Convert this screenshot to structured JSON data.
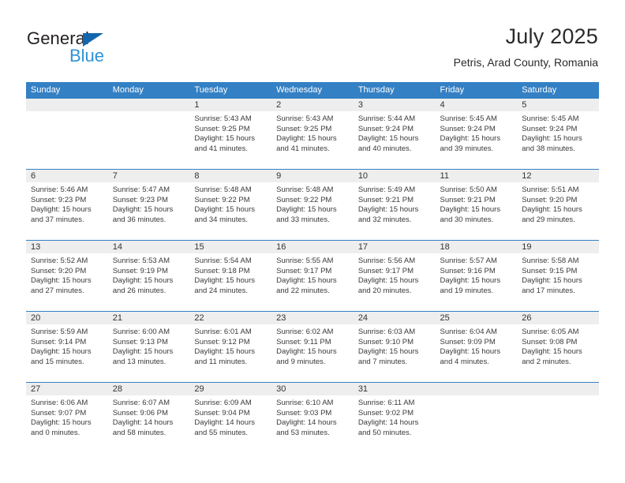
{
  "brand": {
    "name_part1": "General",
    "name_part2": "Blue",
    "triangle_icon": "triangle-icon",
    "accent_dark": "#1266ad",
    "accent_light": "#2e93d8"
  },
  "header": {
    "title": "July 2025",
    "subtitle": "Petris, Arad County, Romania"
  },
  "theme": {
    "header_band": "#3480c4",
    "daynum_band": "#eeeeee",
    "text": "#333333",
    "page_background": "#ffffff"
  },
  "weekdays": [
    "Sunday",
    "Monday",
    "Tuesday",
    "Wednesday",
    "Thursday",
    "Friday",
    "Saturday"
  ],
  "labels": {
    "sunrise_prefix": "Sunrise:",
    "sunset_prefix": "Sunset:",
    "daylight_prefix": "Daylight:"
  },
  "weeks": [
    [
      {
        "day": "",
        "line1": "",
        "line2": "",
        "line3": "",
        "line4": ""
      },
      {
        "day": "",
        "line1": "",
        "line2": "",
        "line3": "",
        "line4": ""
      },
      {
        "day": "1",
        "line1": "Sunrise: 5:43 AM",
        "line2": "Sunset: 9:25 PM",
        "line3": "Daylight: 15 hours",
        "line4": "and 41 minutes."
      },
      {
        "day": "2",
        "line1": "Sunrise: 5:43 AM",
        "line2": "Sunset: 9:25 PM",
        "line3": "Daylight: 15 hours",
        "line4": "and 41 minutes."
      },
      {
        "day": "3",
        "line1": "Sunrise: 5:44 AM",
        "line2": "Sunset: 9:24 PM",
        "line3": "Daylight: 15 hours",
        "line4": "and 40 minutes."
      },
      {
        "day": "4",
        "line1": "Sunrise: 5:45 AM",
        "line2": "Sunset: 9:24 PM",
        "line3": "Daylight: 15 hours",
        "line4": "and 39 minutes."
      },
      {
        "day": "5",
        "line1": "Sunrise: 5:45 AM",
        "line2": "Sunset: 9:24 PM",
        "line3": "Daylight: 15 hours",
        "line4": "and 38 minutes."
      }
    ],
    [
      {
        "day": "6",
        "line1": "Sunrise: 5:46 AM",
        "line2": "Sunset: 9:23 PM",
        "line3": "Daylight: 15 hours",
        "line4": "and 37 minutes."
      },
      {
        "day": "7",
        "line1": "Sunrise: 5:47 AM",
        "line2": "Sunset: 9:23 PM",
        "line3": "Daylight: 15 hours",
        "line4": "and 36 minutes."
      },
      {
        "day": "8",
        "line1": "Sunrise: 5:48 AM",
        "line2": "Sunset: 9:22 PM",
        "line3": "Daylight: 15 hours",
        "line4": "and 34 minutes."
      },
      {
        "day": "9",
        "line1": "Sunrise: 5:48 AM",
        "line2": "Sunset: 9:22 PM",
        "line3": "Daylight: 15 hours",
        "line4": "and 33 minutes."
      },
      {
        "day": "10",
        "line1": "Sunrise: 5:49 AM",
        "line2": "Sunset: 9:21 PM",
        "line3": "Daylight: 15 hours",
        "line4": "and 32 minutes."
      },
      {
        "day": "11",
        "line1": "Sunrise: 5:50 AM",
        "line2": "Sunset: 9:21 PM",
        "line3": "Daylight: 15 hours",
        "line4": "and 30 minutes."
      },
      {
        "day": "12",
        "line1": "Sunrise: 5:51 AM",
        "line2": "Sunset: 9:20 PM",
        "line3": "Daylight: 15 hours",
        "line4": "and 29 minutes."
      }
    ],
    [
      {
        "day": "13",
        "line1": "Sunrise: 5:52 AM",
        "line2": "Sunset: 9:20 PM",
        "line3": "Daylight: 15 hours",
        "line4": "and 27 minutes."
      },
      {
        "day": "14",
        "line1": "Sunrise: 5:53 AM",
        "line2": "Sunset: 9:19 PM",
        "line3": "Daylight: 15 hours",
        "line4": "and 26 minutes."
      },
      {
        "day": "15",
        "line1": "Sunrise: 5:54 AM",
        "line2": "Sunset: 9:18 PM",
        "line3": "Daylight: 15 hours",
        "line4": "and 24 minutes."
      },
      {
        "day": "16",
        "line1": "Sunrise: 5:55 AM",
        "line2": "Sunset: 9:17 PM",
        "line3": "Daylight: 15 hours",
        "line4": "and 22 minutes."
      },
      {
        "day": "17",
        "line1": "Sunrise: 5:56 AM",
        "line2": "Sunset: 9:17 PM",
        "line3": "Daylight: 15 hours",
        "line4": "and 20 minutes."
      },
      {
        "day": "18",
        "line1": "Sunrise: 5:57 AM",
        "line2": "Sunset: 9:16 PM",
        "line3": "Daylight: 15 hours",
        "line4": "and 19 minutes."
      },
      {
        "day": "19",
        "line1": "Sunrise: 5:58 AM",
        "line2": "Sunset: 9:15 PM",
        "line3": "Daylight: 15 hours",
        "line4": "and 17 minutes."
      }
    ],
    [
      {
        "day": "20",
        "line1": "Sunrise: 5:59 AM",
        "line2": "Sunset: 9:14 PM",
        "line3": "Daylight: 15 hours",
        "line4": "and 15 minutes."
      },
      {
        "day": "21",
        "line1": "Sunrise: 6:00 AM",
        "line2": "Sunset: 9:13 PM",
        "line3": "Daylight: 15 hours",
        "line4": "and 13 minutes."
      },
      {
        "day": "22",
        "line1": "Sunrise: 6:01 AM",
        "line2": "Sunset: 9:12 PM",
        "line3": "Daylight: 15 hours",
        "line4": "and 11 minutes."
      },
      {
        "day": "23",
        "line1": "Sunrise: 6:02 AM",
        "line2": "Sunset: 9:11 PM",
        "line3": "Daylight: 15 hours",
        "line4": "and 9 minutes."
      },
      {
        "day": "24",
        "line1": "Sunrise: 6:03 AM",
        "line2": "Sunset: 9:10 PM",
        "line3": "Daylight: 15 hours",
        "line4": "and 7 minutes."
      },
      {
        "day": "25",
        "line1": "Sunrise: 6:04 AM",
        "line2": "Sunset: 9:09 PM",
        "line3": "Daylight: 15 hours",
        "line4": "and 4 minutes."
      },
      {
        "day": "26",
        "line1": "Sunrise: 6:05 AM",
        "line2": "Sunset: 9:08 PM",
        "line3": "Daylight: 15 hours",
        "line4": "and 2 minutes."
      }
    ],
    [
      {
        "day": "27",
        "line1": "Sunrise: 6:06 AM",
        "line2": "Sunset: 9:07 PM",
        "line3": "Daylight: 15 hours",
        "line4": "and 0 minutes."
      },
      {
        "day": "28",
        "line1": "Sunrise: 6:07 AM",
        "line2": "Sunset: 9:06 PM",
        "line3": "Daylight: 14 hours",
        "line4": "and 58 minutes."
      },
      {
        "day": "29",
        "line1": "Sunrise: 6:09 AM",
        "line2": "Sunset: 9:04 PM",
        "line3": "Daylight: 14 hours",
        "line4": "and 55 minutes."
      },
      {
        "day": "30",
        "line1": "Sunrise: 6:10 AM",
        "line2": "Sunset: 9:03 PM",
        "line3": "Daylight: 14 hours",
        "line4": "and 53 minutes."
      },
      {
        "day": "31",
        "line1": "Sunrise: 6:11 AM",
        "line2": "Sunset: 9:02 PM",
        "line3": "Daylight: 14 hours",
        "line4": "and 50 minutes."
      },
      {
        "day": "",
        "line1": "",
        "line2": "",
        "line3": "",
        "line4": ""
      },
      {
        "day": "",
        "line1": "",
        "line2": "",
        "line3": "",
        "line4": ""
      }
    ]
  ]
}
